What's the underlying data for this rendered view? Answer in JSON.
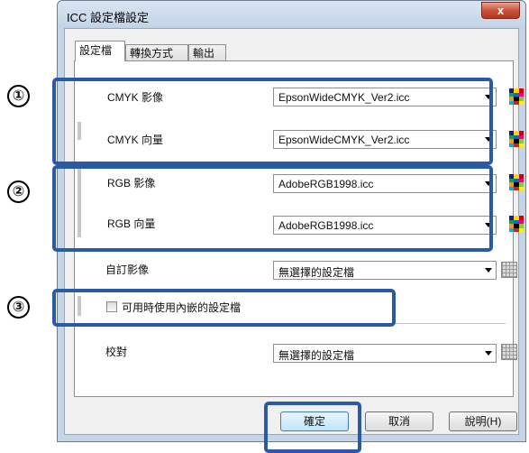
{
  "window": {
    "title": "ICC 設定檔設定",
    "close_glyph": "x"
  },
  "tabs": [
    {
      "label": "設定檔"
    },
    {
      "label": "轉換方式"
    },
    {
      "label": "輸出"
    }
  ],
  "profiles": {
    "cmyk_image": {
      "label": "CMYK 影像",
      "value": "EpsonWideCMYK_Ver2.icc"
    },
    "cmyk_vector": {
      "label": "CMYK 向量",
      "value": "EpsonWideCMYK_Ver2.icc"
    },
    "rgb_image": {
      "label": "RGB 影像",
      "value": "AdobeRGB1998.icc"
    },
    "rgb_vector": {
      "label": "RGB 向量",
      "value": "AdobeRGB1998.icc"
    },
    "custom_image": {
      "label": "自訂影像",
      "value": "無選擇的設定檔"
    },
    "embedded_checkbox": {
      "label": "可用時使用內嵌的設定檔",
      "checked": false
    },
    "proof": {
      "label": "校對",
      "value": "無選擇的設定檔"
    }
  },
  "buttons": {
    "ok": "確定",
    "cancel": "取消",
    "help": "說明(H)"
  },
  "markers": [
    "①",
    "②",
    "③"
  ],
  "colors": {
    "callout": "#2a5aa3",
    "titlebar": "#c5d5e8",
    "close": "#c8533c"
  },
  "icons": {
    "color_profile": "color-grid-icon",
    "gray_profile": "gray-grid-icon"
  }
}
